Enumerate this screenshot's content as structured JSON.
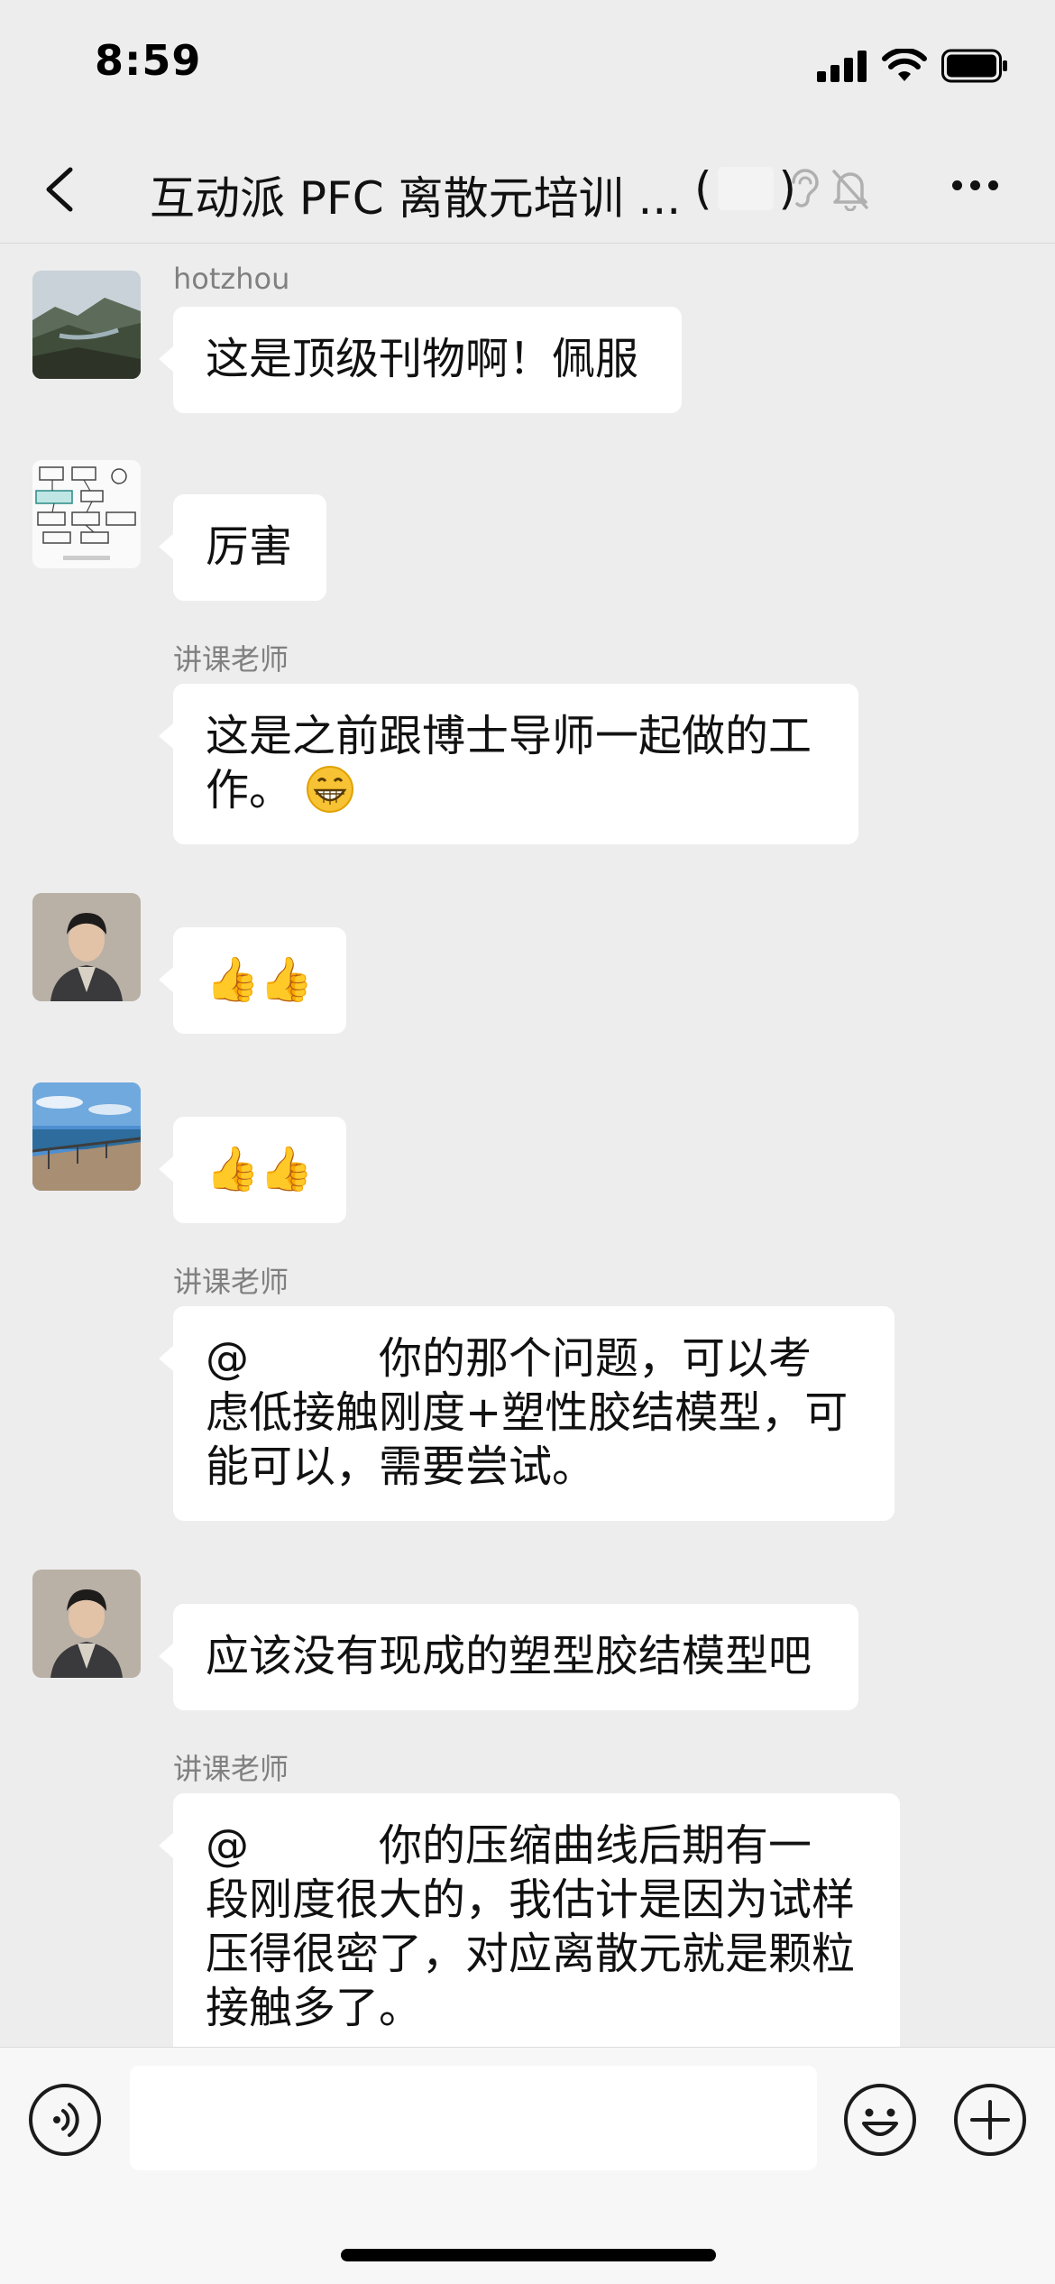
{
  "status_bar": {
    "time": "8:59",
    "icons": [
      "cellular-signal-icon",
      "wifi-icon",
      "battery-icon"
    ]
  },
  "nav": {
    "back_icon": "chevron-left-icon",
    "title": "互动派 PFC 离散元培训 ...",
    "title_open": "(",
    "title_close": ")",
    "icons": [
      "ear-icon",
      "bell-off-icon",
      "more-icon"
    ]
  },
  "messages": [
    {
      "sender": "hotzhou",
      "avatar": "landscape-mountain",
      "text": "这是顶级刊物啊！佩服"
    },
    {
      "sender": "",
      "avatar": "flowchart-sketch",
      "text": "厉害"
    },
    {
      "sender": "讲课老师",
      "avatar": "none",
      "text_line1": "这是之前跟博士导师一起做的工",
      "text_line2": "作。",
      "emoji": "grinning-face"
    },
    {
      "sender": "",
      "avatar": "person-portrait",
      "text": "👍👍"
    },
    {
      "sender": "",
      "avatar": "seaside-pier",
      "text": "👍👍"
    },
    {
      "sender": "讲课老师",
      "avatar": "none",
      "mention": "@",
      "text_line1": "你的那个问题，可以考",
      "text_line2": "虑低接触刚度+塑性胶结模型，可",
      "text_line3": "能可以，需要尝试。"
    },
    {
      "sender": "",
      "avatar": "person-portrait",
      "text": "应该没有现成的塑型胶结模型吧"
    },
    {
      "sender": "讲课老师",
      "avatar": "none",
      "mention": "@",
      "text_line1": "你的压缩曲线后期有一",
      "text_line2": "段刚度很大的，我估计是因为试样",
      "text_line3": "压得很密了，对应离散元就是颗粒",
      "text_line4": "接触多了。"
    }
  ],
  "input_bar": {
    "placeholder": "",
    "icons": [
      "voice-icon",
      "emoji-icon",
      "plus-icon"
    ]
  },
  "colors": {
    "background": "#ededed",
    "bubble": "#ffffff",
    "sender_name": "#808080"
  }
}
